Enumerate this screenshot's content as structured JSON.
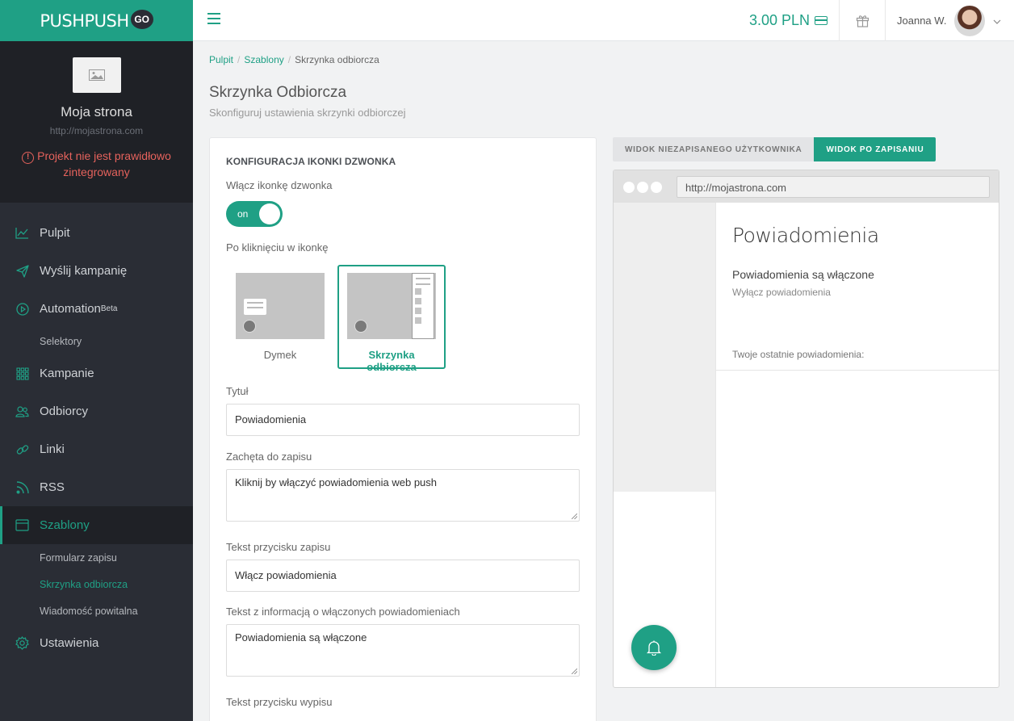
{
  "brand": {
    "name": "PUSHPUSH",
    "badge": "GO",
    "accent": "#1fa085"
  },
  "site": {
    "name": "Moja strona",
    "url": "http://mojastrona.com",
    "warning_icon": "exclamation-circle-icon",
    "warning": "Projekt nie jest prawidłowo zintegrowany"
  },
  "nav": {
    "pulpit": "Pulpit",
    "wyslij": "Wyślij kampanię",
    "automation": "Automation",
    "automation_badge": "Beta",
    "selektory": "Selektory",
    "kampanie": "Kampanie",
    "odbiorcy": "Odbiorcy",
    "linki": "Linki",
    "rss": "RSS",
    "szablony": "Szablony",
    "formularz": "Formularz zapisu",
    "skrzynka": "Skrzynka odbiorcza",
    "wiadomosc": "Wiadomość powitalna",
    "ustawienia": "Ustawienia"
  },
  "topbar": {
    "balance": "3.00 PLN",
    "user_name": "Joanna W."
  },
  "breadcrumb": {
    "home": "Pulpit",
    "parent": "Szablony",
    "current": "Skrzynka odbiorcza",
    "separator": "/"
  },
  "page": {
    "title": "Skrzynka Odbiorcza",
    "subtitle": "Skonfiguruj ustawienia skrzynki odbiorczej"
  },
  "config": {
    "heading": "KONFIGURACJA IKONKI DZWONKA",
    "enable_label": "Włącz ikonkę dzwonka",
    "toggle_value": "on",
    "click_label": "Po kliknięciu w ikonkę",
    "option_bubble": "Dymek",
    "option_inbox": "Skrzynka odbiorcza",
    "selected_option": "Skrzynka odbiorcza",
    "title_label": "Tytuł",
    "title_value": "Powiadomienia",
    "prompt_label": "Zachęta do zapisu",
    "prompt_value": "Kliknij by włączyć powiadomienia web push",
    "sub_btn_label": "Tekst przycisku zapisu",
    "sub_btn_value": "Włącz powiadomienia",
    "enabled_info_label": "Tekst z informacją o włączonych powiadomieniach",
    "enabled_info_value": "Powiadomienia są włączone",
    "unsub_btn_label": "Tekst przycisku wypisu"
  },
  "preview": {
    "tab_unsaved": "WIDOK NIEZAPISANEGO UŻYTKOWNIKA",
    "tab_saved": "WIDOK PO ZAPISANIU",
    "url": "http://mojastrona.com",
    "title": "Powiadomienia",
    "status": "Powiadomienia są włączone",
    "unsubscribe": "Wyłącz powiadomienia",
    "recent": "Twoje ostatnie powiadomienia:"
  }
}
